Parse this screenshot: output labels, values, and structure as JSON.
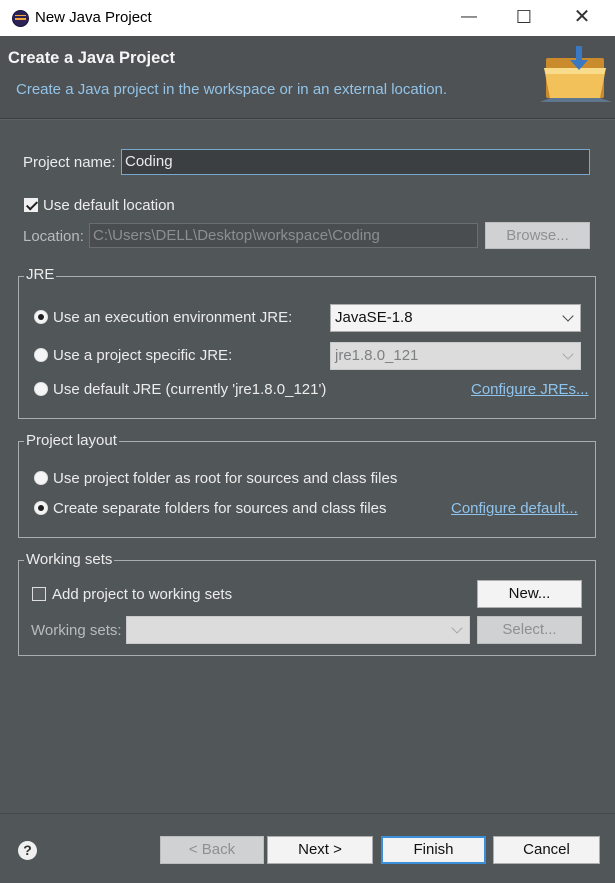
{
  "window": {
    "title": "New Java Project",
    "controls": {
      "minimize": "—",
      "maximize": "☐",
      "close": "✕"
    }
  },
  "header": {
    "title": "Create a Java Project",
    "description": "Create a Java project in the workspace or in an external location."
  },
  "project": {
    "name_label": "Project name:",
    "name_value": "Coding"
  },
  "location": {
    "use_default_label": "Use default location",
    "use_default_checked": true,
    "label": "Location:",
    "value": "C:\\Users\\DELL\\Desktop\\workspace\\Coding",
    "browse_label": "Browse..."
  },
  "jre": {
    "group_title": "JRE",
    "options": [
      {
        "label": "Use an execution environment JRE:",
        "selected": true
      },
      {
        "label": "Use a project specific JRE:",
        "selected": false
      },
      {
        "label": "Use default JRE (currently 'jre1.8.0_121')",
        "selected": false
      }
    ],
    "execution_env_value": "JavaSE-1.8",
    "project_jre_value": "jre1.8.0_121",
    "configure_link": "Configure JREs..."
  },
  "layout": {
    "group_title": "Project layout",
    "options": [
      {
        "label": "Use project folder as root for sources and class files",
        "selected": false
      },
      {
        "label": "Create separate folders for sources and class files",
        "selected": true
      }
    ],
    "configure_link": "Configure default..."
  },
  "working_sets": {
    "group_title": "Working sets",
    "add_label": "Add project to working sets",
    "add_checked": false,
    "new_label": "New...",
    "sets_label": "Working sets:",
    "sets_value": "",
    "select_label": "Select..."
  },
  "footer": {
    "help": "?",
    "back_label": "< Back",
    "next_label": "Next >",
    "finish_label": "Finish",
    "cancel_label": "Cancel"
  },
  "icons": {
    "app": "eclipse-icon",
    "header": "folder-wizard-icon",
    "help": "help-icon"
  }
}
